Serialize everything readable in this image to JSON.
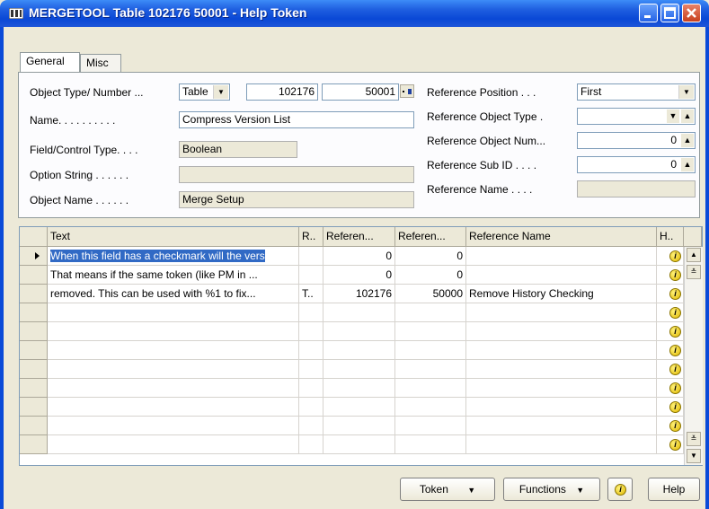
{
  "window": {
    "title": "MERGETOOL Table 102176 50001 - Help Token"
  },
  "tabs": [
    {
      "label": "General"
    },
    {
      "label": "Misc"
    }
  ],
  "general": {
    "object_type_label": "Object Type/ Number ...",
    "object_type_value": "Table",
    "object_number": "102176",
    "object_sub": "50001",
    "name_label": "Name. . . . . . . . . .",
    "name_value": "Compress Version List",
    "field_type_label": "Field/Control Type. . . .",
    "field_type_value": "Boolean",
    "option_string_label": "Option String . . . . . .",
    "option_string_value": "",
    "object_name_label": "Object Name . . . . . .",
    "object_name_value": "Merge Setup",
    "ref_position_label": "Reference Position . . .",
    "ref_position_value": "First",
    "ref_object_type_label": "Reference Object Type .",
    "ref_object_type_value": "",
    "ref_object_num_label": "Reference Object Num...",
    "ref_object_num_value": "0",
    "ref_sub_id_label": "Reference Sub ID . . . .",
    "ref_sub_id_value": "0",
    "ref_name_label": "Reference Name . . . .",
    "ref_name_value": ""
  },
  "grid": {
    "columns": [
      "Text",
      "R..",
      "Referen...",
      "Referen...",
      "Reference Name",
      "H.."
    ],
    "rows": [
      {
        "text": "When this field has a checkmark will the vers",
        "r": "",
        "ref1": "0",
        "ref2": "0",
        "refname": ""
      },
      {
        "text": "That means if the same token (like PM in ...",
        "r": "",
        "ref1": "0",
        "ref2": "0",
        "refname": ""
      },
      {
        "text": "removed. This can be used with %1 to fix...",
        "r": "T..",
        "ref1": "102176",
        "ref2": "50000",
        "refname": "Remove History Checking"
      },
      {
        "text": "",
        "r": "",
        "ref1": "",
        "ref2": "",
        "refname": ""
      },
      {
        "text": "",
        "r": "",
        "ref1": "",
        "ref2": "",
        "refname": ""
      },
      {
        "text": "",
        "r": "",
        "ref1": "",
        "ref2": "",
        "refname": ""
      },
      {
        "text": "",
        "r": "",
        "ref1": "",
        "ref2": "",
        "refname": ""
      },
      {
        "text": "",
        "r": "",
        "ref1": "",
        "ref2": "",
        "refname": ""
      },
      {
        "text": "",
        "r": "",
        "ref1": "",
        "ref2": "",
        "refname": ""
      },
      {
        "text": "",
        "r": "",
        "ref1": "",
        "ref2": "",
        "refname": ""
      },
      {
        "text": "",
        "r": "",
        "ref1": "",
        "ref2": "",
        "refname": ""
      }
    ]
  },
  "buttons": {
    "token": "Token",
    "functions": "Functions",
    "help": "Help"
  },
  "icons": {
    "info": "info-icon",
    "dropdown": "chevron-down-icon",
    "lookup": "arrow-up-icon"
  }
}
